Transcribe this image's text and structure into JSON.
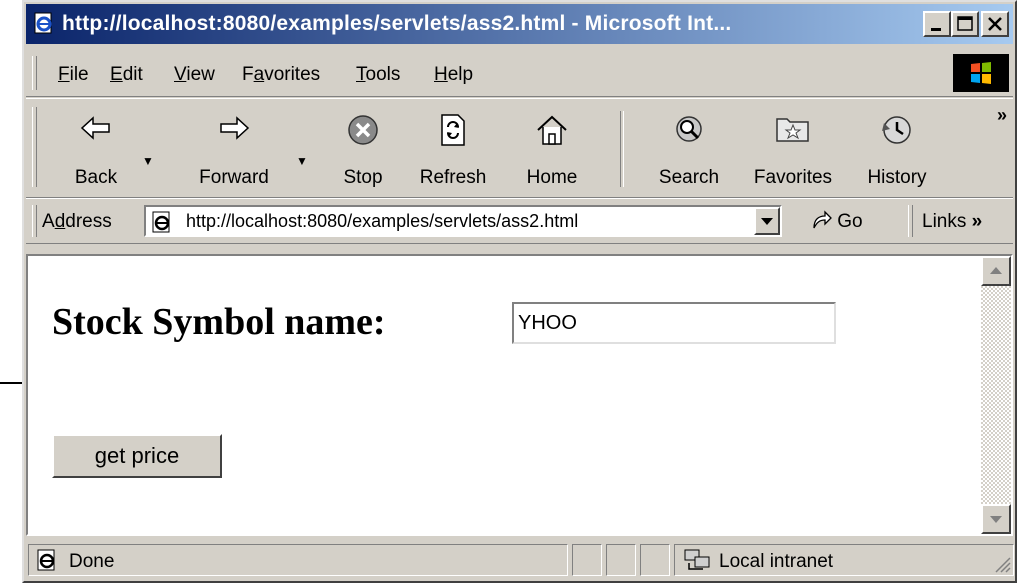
{
  "window": {
    "title": "http://localhost:8080/examples/servlets/ass2.html - Microsoft Int...",
    "controls": [
      "minimize-icon",
      "maximize-icon",
      "close-icon"
    ]
  },
  "menu": [
    {
      "pre": "",
      "ul": "F",
      "post": "ile"
    },
    {
      "pre": "",
      "ul": "E",
      "post": "dit"
    },
    {
      "pre": "",
      "ul": "V",
      "post": "iew"
    },
    {
      "pre": "F",
      "ul": "a",
      "post": "vorites"
    },
    {
      "pre": "",
      "ul": "T",
      "post": "ools"
    },
    {
      "pre": "",
      "ul": "H",
      "post": "elp"
    }
  ],
  "toolbar": {
    "back": "Back",
    "forward": "Forward",
    "stop": "Stop",
    "refresh": "Refresh",
    "home": "Home",
    "search": "Search",
    "favorites": "Favorites",
    "history": "History",
    "more": "»"
  },
  "address": {
    "label_pre": "A",
    "label_ul": "d",
    "label_post": "dress",
    "url": "http://localhost:8080/examples/servlets/ass2.html",
    "go": "Go",
    "links": "Links",
    "links_more": "»"
  },
  "page": {
    "heading": "Stock Symbol name:",
    "symbol_value": "YHOO",
    "button_label": "get price"
  },
  "status": {
    "text": "Done",
    "zone": "Local intranet"
  },
  "colors": {
    "titlebar_start": "#0a246a",
    "titlebar_end": "#a6caf0",
    "chrome": "#d4d0c8"
  }
}
